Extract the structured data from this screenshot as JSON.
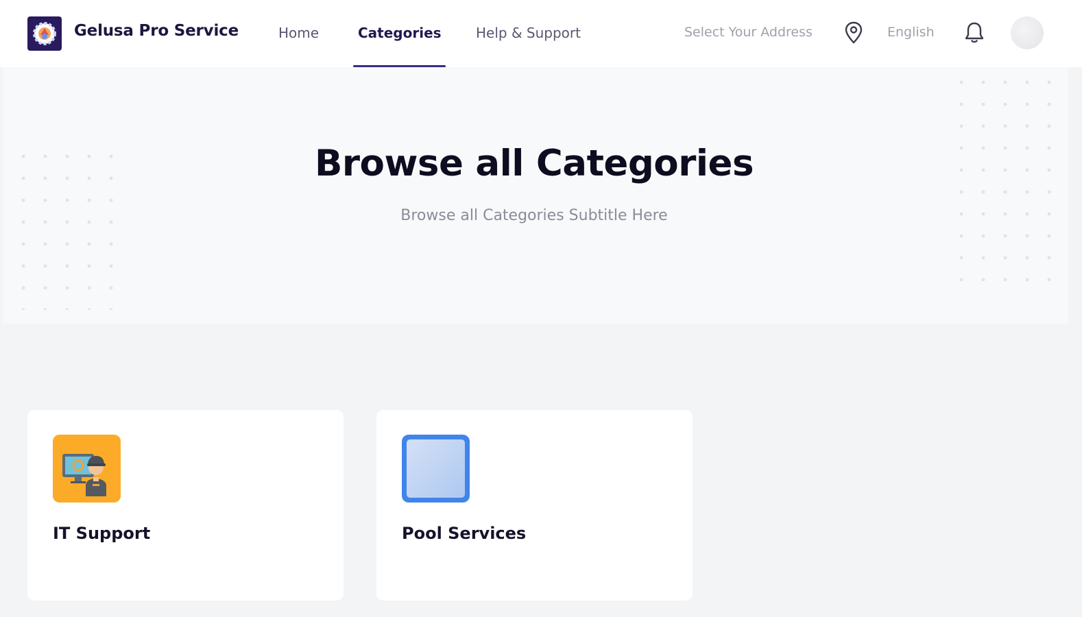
{
  "header": {
    "brand": "Gelusa Pro Service",
    "nav": [
      {
        "label": "Home",
        "active": false
      },
      {
        "label": "Categories",
        "active": true
      },
      {
        "label": "Help & Support",
        "active": false
      }
    ],
    "address_placeholder": "Select Your Address",
    "language": "English"
  },
  "hero": {
    "title": "Browse all Categories",
    "subtitle": "Browse all Categories Subtitle Here"
  },
  "categories": [
    {
      "name": "IT Support",
      "icon": "it-support-icon",
      "icon_bg": "#fbab27"
    },
    {
      "name": "Pool Services",
      "icon": "pool-services-icon",
      "icon_bg": "#3f85ea"
    }
  ],
  "colors": {
    "brand": "#2a1a5e",
    "nav_active": "#24184f",
    "underline": "#3b2b87"
  }
}
